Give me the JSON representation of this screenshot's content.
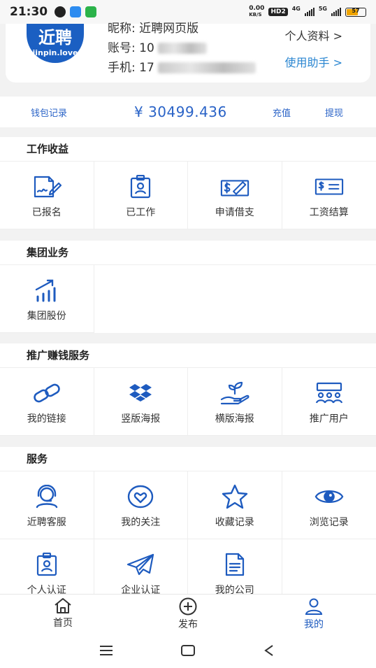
{
  "status_bar": {
    "time": "21:30",
    "net_speed": "0.00",
    "net_unit": "KB/S",
    "hd": "HD2",
    "net1": "4G",
    "net2": "5G",
    "battery": "57"
  },
  "profile": {
    "logo_line1": "近聘",
    "logo_line2": "jinpin.love",
    "nickname": "昵称: 近聘网页版",
    "account_label": "账号: 10",
    "phone_label": "手机: 17",
    "personal_info": "个人资料 >",
    "help": "使用助手 >",
    "link_color": "#2a86d1"
  },
  "wallet": {
    "records": "钱包记录",
    "balance": "¥ 30499.436",
    "recharge": "充值",
    "withdraw": "提现",
    "accent": "#2a63c7"
  },
  "sections": {
    "work": {
      "title": "工作收益",
      "items": [
        "已报名",
        "已工作",
        "申请借支",
        "工资结算"
      ]
    },
    "group": {
      "title": "集团业务",
      "items": [
        "集团股份"
      ]
    },
    "promo": {
      "title": "推广赚钱服务",
      "items": [
        "我的链接",
        "竖版海报",
        "横版海报",
        "推广用户"
      ]
    },
    "service": {
      "title": "服务",
      "items": [
        "近聘客服",
        "我的关注",
        "收藏记录",
        "浏览记录",
        "个人认证",
        "企业认证",
        "我的公司"
      ]
    }
  },
  "tabbar": {
    "home": "首页",
    "publish": "发布",
    "mine": "我的",
    "active_color": "#1e5bbf"
  },
  "icon_color": "#1e5bbf"
}
